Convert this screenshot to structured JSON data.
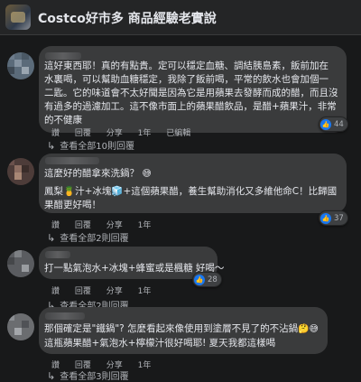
{
  "header": {
    "title": "Costco好市多 商品經驗老實說"
  },
  "comments": [
    {
      "lines": [
        "這好東西耶！真的有點貴。定可以穩定血糖、調結胰島素，飯前加在",
        "水裏喝，可以幫助血糖穩定，我除了飯前喝，平常的飲水也會加個一",
        "二匙。它的味道會不太好聞是因為它是用蘋果去發酵而成的醋，而且沒",
        "有過多的過濾加工。這不像市面上的蘋果醋飲品，是醋+蘋果汁，非常",
        "的不健康"
      ],
      "actions": [
        "讚",
        "回覆",
        "分享",
        "1年",
        "已編輯"
      ],
      "reactions": "44",
      "view_replies": "查看全部10則回覆"
    },
    {
      "lines": [
        "這麼好的醋拿來洗鍋？",
        "鳳梨🍍汁+冰塊🧊+這個蘋果醋，養生幫助消化又多維他命C！比歸國",
        "果醋更好喝！"
      ],
      "actions": [
        "讚",
        "回覆",
        "分享",
        "1年"
      ],
      "reactions": "37",
      "view_replies": "查看全部2則回覆"
    },
    {
      "lines": [
        "打一點氣泡水+冰塊+蜂蜜或是楓糖 好喝～"
      ],
      "actions": [
        "讚",
        "回覆",
        "分享",
        "1年"
      ],
      "reactions": "28",
      "view_replies": "查看全部2則回覆"
    },
    {
      "lines": [
        "那個確定是\"鐵鍋\"? 怎麼看起來像使用到塗層不見了的不沾鍋",
        "這瓶蘋果醋+氣泡水+檸檬汁很好喝耶! 夏天我都這樣喝"
      ],
      "actions": [
        "讚",
        "回覆",
        "分享",
        "1年"
      ],
      "view_replies": "查看全部3則回覆"
    }
  ],
  "colors": {
    "background": "#18191a",
    "bubble": "#3a3b3c",
    "like": "#1877f2"
  }
}
